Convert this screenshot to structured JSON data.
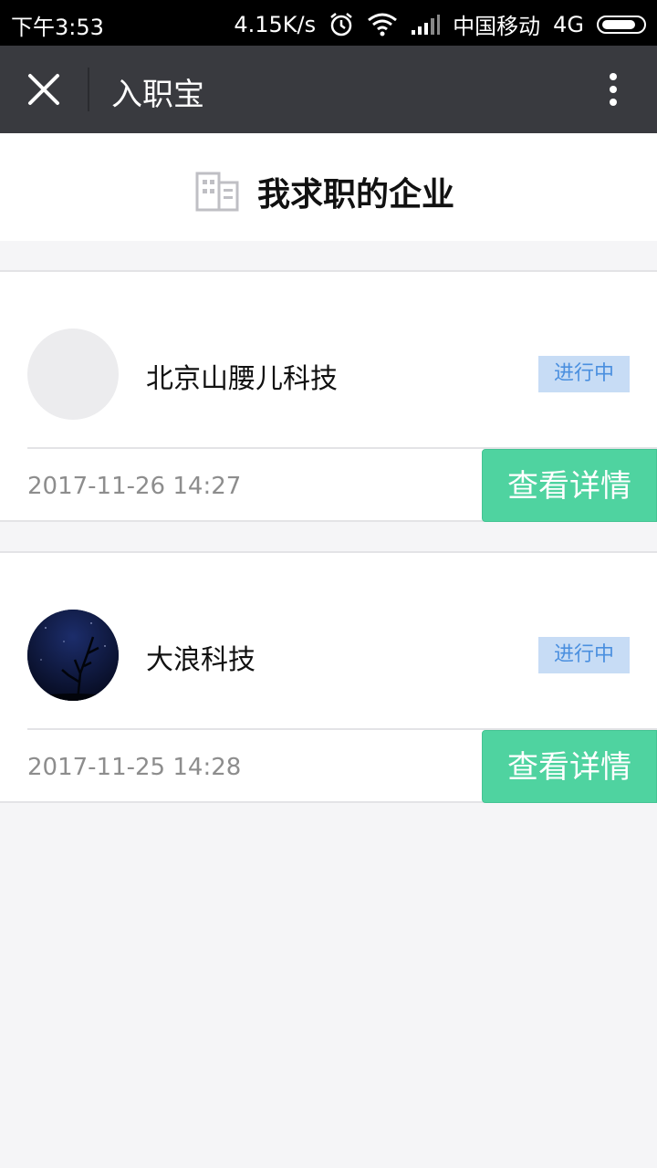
{
  "status_bar": {
    "time": "下午3:53",
    "speed": "4.15K/s",
    "carrier": "中国移动",
    "network": "4G"
  },
  "nav": {
    "title": "入职宝",
    "close_icon": "close-icon",
    "more_icon": "more-vertical-icon"
  },
  "header": {
    "icon": "building-icon",
    "title": "我求职的企业"
  },
  "applications": [
    {
      "company": "北京山腰儿科技",
      "status": "进行中",
      "date": "2017-11-26 14:27",
      "button_label": "查看详情",
      "avatar": "blank"
    },
    {
      "company": "大浪科技",
      "status": "进行中",
      "date": "2017-11-25 14:28",
      "button_label": "查看详情",
      "avatar": "night-sky-photo"
    }
  ],
  "colors": {
    "nav_bg": "#393a3f",
    "badge_bg": "#c7dcf5",
    "badge_text": "#4a8fdf",
    "button_bg": "#4fd3a0",
    "page_bg": "#f5f5f7"
  }
}
